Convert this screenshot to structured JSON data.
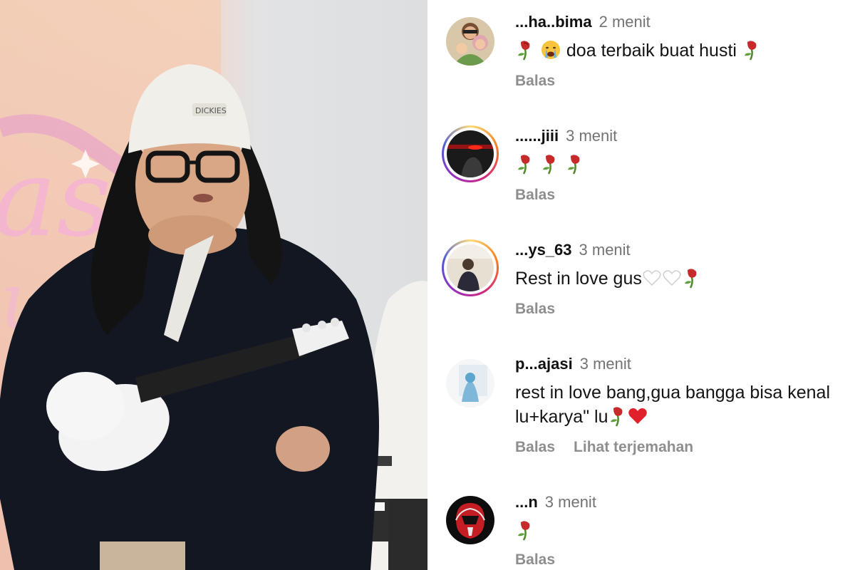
{
  "comments": [
    {
      "username": "...ha..bima",
      "time": "2 menit",
      "text": "doa terbaik buat husti",
      "prefix_emojis": [
        "wilted-rose-icon",
        "crying-face-icon"
      ],
      "suffix_emojis": [
        "wilted-rose-icon"
      ],
      "actions": [
        "Balas"
      ]
    },
    {
      "username": "......jiii",
      "time": "3 menit",
      "text": "",
      "prefix_emojis": [
        "wilted-rose-icon",
        "wilted-rose-icon",
        "wilted-rose-icon"
      ],
      "suffix_emojis": [],
      "actions": [
        "Balas"
      ]
    },
    {
      "username": "...ys_63",
      "time": "3 menit",
      "text": "Rest in love gus",
      "prefix_emojis": [],
      "suffix_emojis": [
        "white-heart-icon",
        "white-heart-icon",
        "wilted-rose-icon"
      ],
      "actions": [
        "Balas"
      ]
    },
    {
      "username": "p...ajasi",
      "time": "3 menit",
      "text_line1": "rest in love bang,gua bangga bisa kenal",
      "text_line2": "lu+karya\" lu",
      "suffix_emojis": [
        "wilted-rose-icon",
        "red-heart-icon"
      ],
      "actions": [
        "Balas",
        "Lihat terjemahan"
      ]
    },
    {
      "username": "...n",
      "time": "3 menit",
      "text": "",
      "prefix_emojis": [
        "wilted-rose-icon"
      ],
      "suffix_emojis": [],
      "actions": [
        "Balas"
      ]
    }
  ],
  "photo": {
    "hat_text": "DICKIES",
    "banner_text": "ash"
  },
  "colors": {
    "action_gray": "#8e8e8e",
    "time_gray": "#737373",
    "story_ring": "#d62976"
  }
}
